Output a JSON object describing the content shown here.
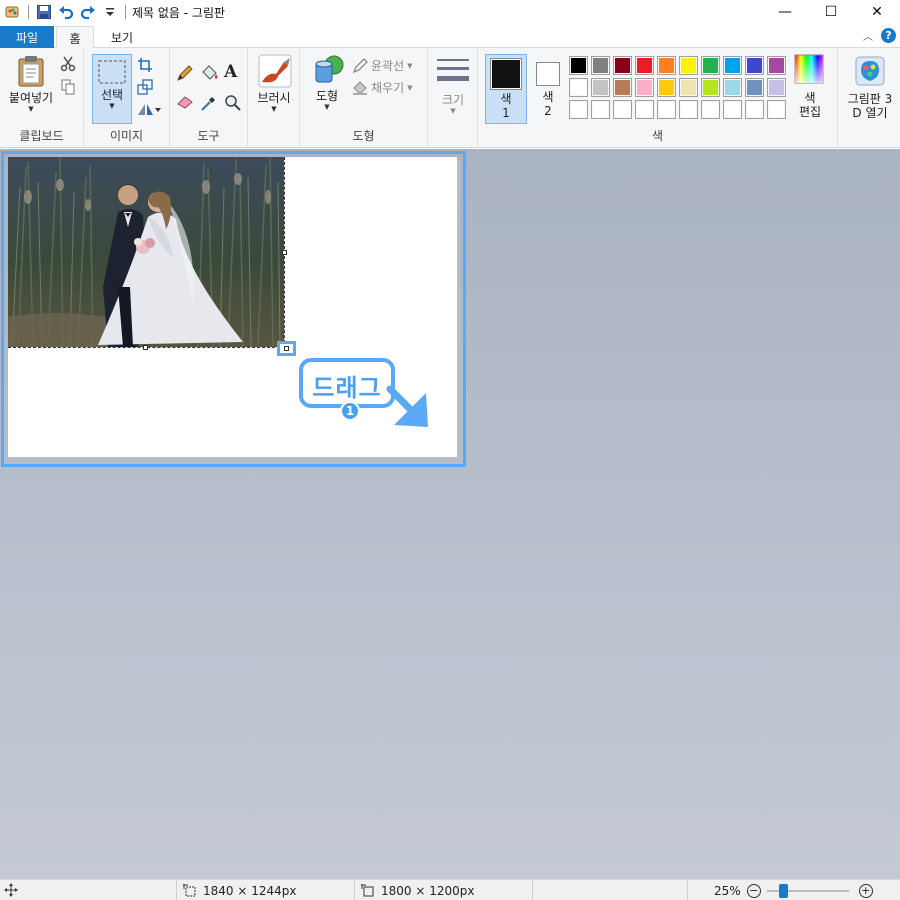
{
  "titlebar": {
    "title": "제목 없음 - 그림판",
    "minimize": "—",
    "maximize": "☐",
    "close": "✕"
  },
  "tabs": {
    "file": "파일",
    "home": "홈",
    "view": "보기"
  },
  "clipboard": {
    "paste": "붙여넣기",
    "group": "클립보드"
  },
  "image": {
    "select": "선택",
    "group": "이미지"
  },
  "tools": {
    "group": "도구"
  },
  "brushes": {
    "label": "브러시"
  },
  "shapes": {
    "label": "도형",
    "outline": "윤곽선",
    "fill": "채우기",
    "group": "도형"
  },
  "size": {
    "label": "크기"
  },
  "colors": {
    "color1_a": "색",
    "color1_b": "1",
    "color2_a": "색",
    "color2_b": "2",
    "edit_a": "색",
    "edit_b": "편집",
    "group": "색",
    "color1_value": "#111111",
    "color2_value": "#ffffff",
    "palette_row1": [
      "#000000",
      "#7f7f7f",
      "#880015",
      "#ed1c24",
      "#ff7f27",
      "#fff200",
      "#22b14c",
      "#00a2e8",
      "#3f48cc",
      "#a349a4"
    ],
    "palette_row2": [
      "#ffffff",
      "#c3c3c3",
      "#b97a57",
      "#ffaec9",
      "#ffc90e",
      "#efe4b0",
      "#b5e61d",
      "#99d9ea",
      "#7092be",
      "#c8bfe7"
    ],
    "palette_row3": [
      "#ffffff",
      "#ffffff",
      "#ffffff",
      "#ffffff",
      "#ffffff",
      "#ffffff",
      "#ffffff",
      "#ffffff",
      "#ffffff",
      "#ffffff"
    ]
  },
  "paint3d": {
    "line1": "그림판 3",
    "line2": "D 열기"
  },
  "callout": {
    "text": "드래그",
    "number": "1"
  },
  "status": {
    "selection_size": "1840 × 1244px",
    "canvas_size": "1800 × 1200px",
    "zoom": "25%",
    "zoom_level": 0.25
  }
}
